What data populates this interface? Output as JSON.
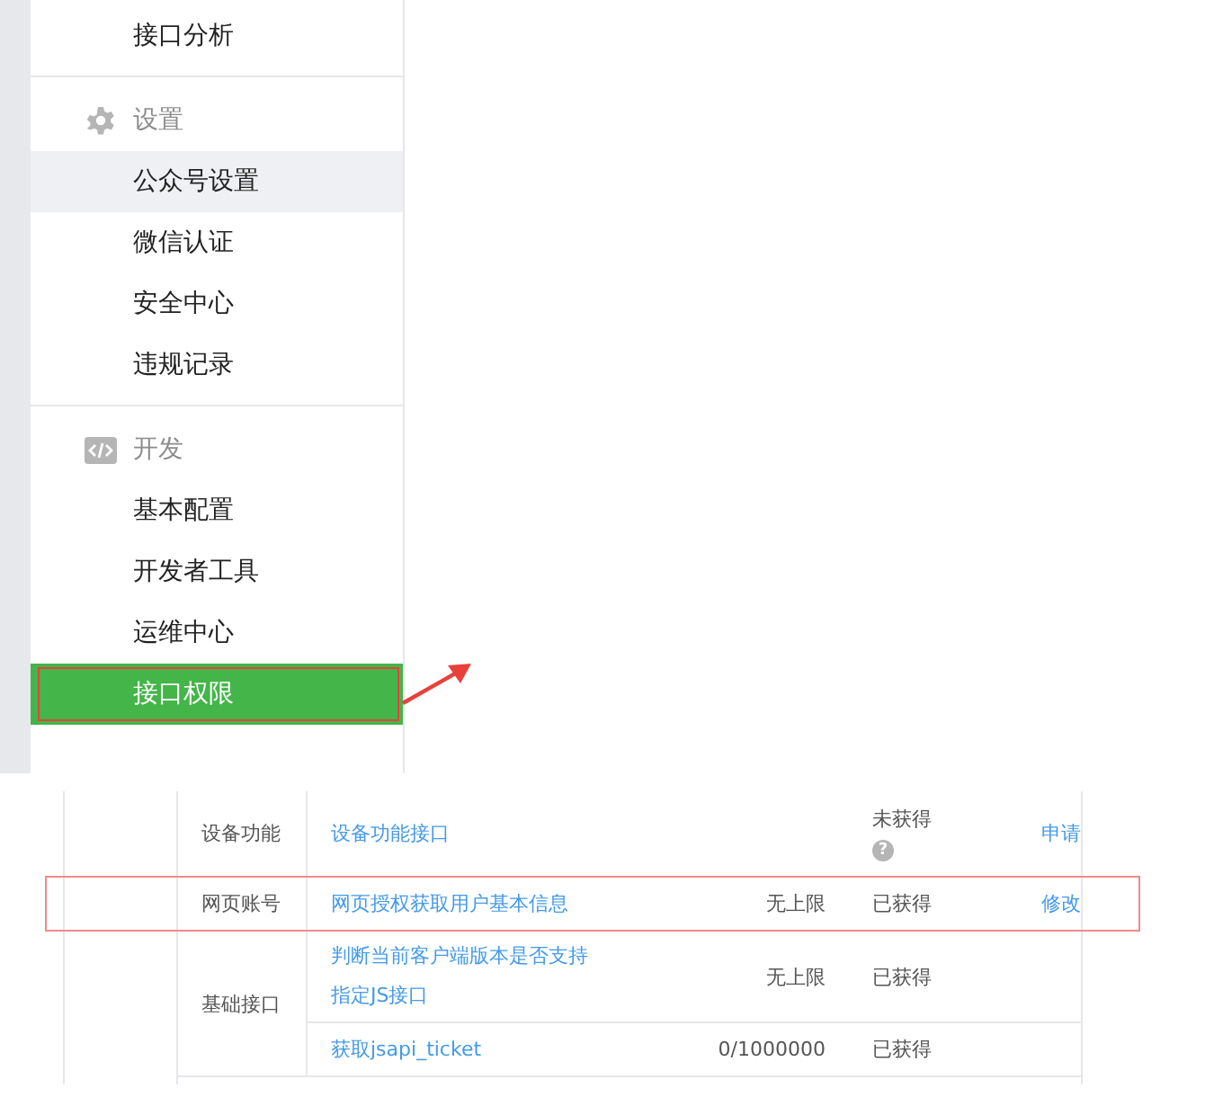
{
  "sidebar": {
    "groups": [
      {
        "kind": "plain",
        "items": [
          {
            "label": "接口分析",
            "selected": false,
            "hovered": false,
            "annotated": false
          }
        ]
      },
      {
        "kind": "settings",
        "title": "设置",
        "items": [
          {
            "label": "公众号设置",
            "selected": false,
            "hovered": true,
            "annotated": false
          },
          {
            "label": "微信认证",
            "selected": false,
            "hovered": false,
            "annotated": false
          },
          {
            "label": "安全中心",
            "selected": false,
            "hovered": false,
            "annotated": false
          },
          {
            "label": "违规记录",
            "selected": false,
            "hovered": false,
            "annotated": false
          }
        ]
      },
      {
        "kind": "developer",
        "title": "开发",
        "items": [
          {
            "label": "基本配置",
            "selected": false,
            "hovered": false,
            "annotated": false
          },
          {
            "label": "开发者工具",
            "selected": false,
            "hovered": false,
            "annotated": false
          },
          {
            "label": "运维中心",
            "selected": false,
            "hovered": false,
            "annotated": false
          },
          {
            "label": "接口权限",
            "selected": true,
            "hovered": false,
            "annotated": true
          }
        ]
      }
    ]
  },
  "table": {
    "groups": [
      {
        "category": "设备功能",
        "rows": [
          {
            "name": "设备功能接口",
            "status": "未获得",
            "help": "?",
            "action": "申请",
            "annotated": false
          }
        ]
      },
      {
        "category": "网页账号",
        "rows": [
          {
            "name": "网页授权获取用户基本信息",
            "limit": "无上限",
            "status": "已获得",
            "action": "修改",
            "annotated": true
          }
        ]
      },
      {
        "category": "基础接口",
        "rows": [
          {
            "name": "判断当前客户端版本是否支持指定JS接口",
            "limit": "无上限",
            "status": "已获得",
            "annotated": false
          },
          {
            "name": "获取jsapi_ticket",
            "limit": "0/1000000",
            "status": "已获得",
            "annotated": false
          }
        ]
      }
    ]
  }
}
